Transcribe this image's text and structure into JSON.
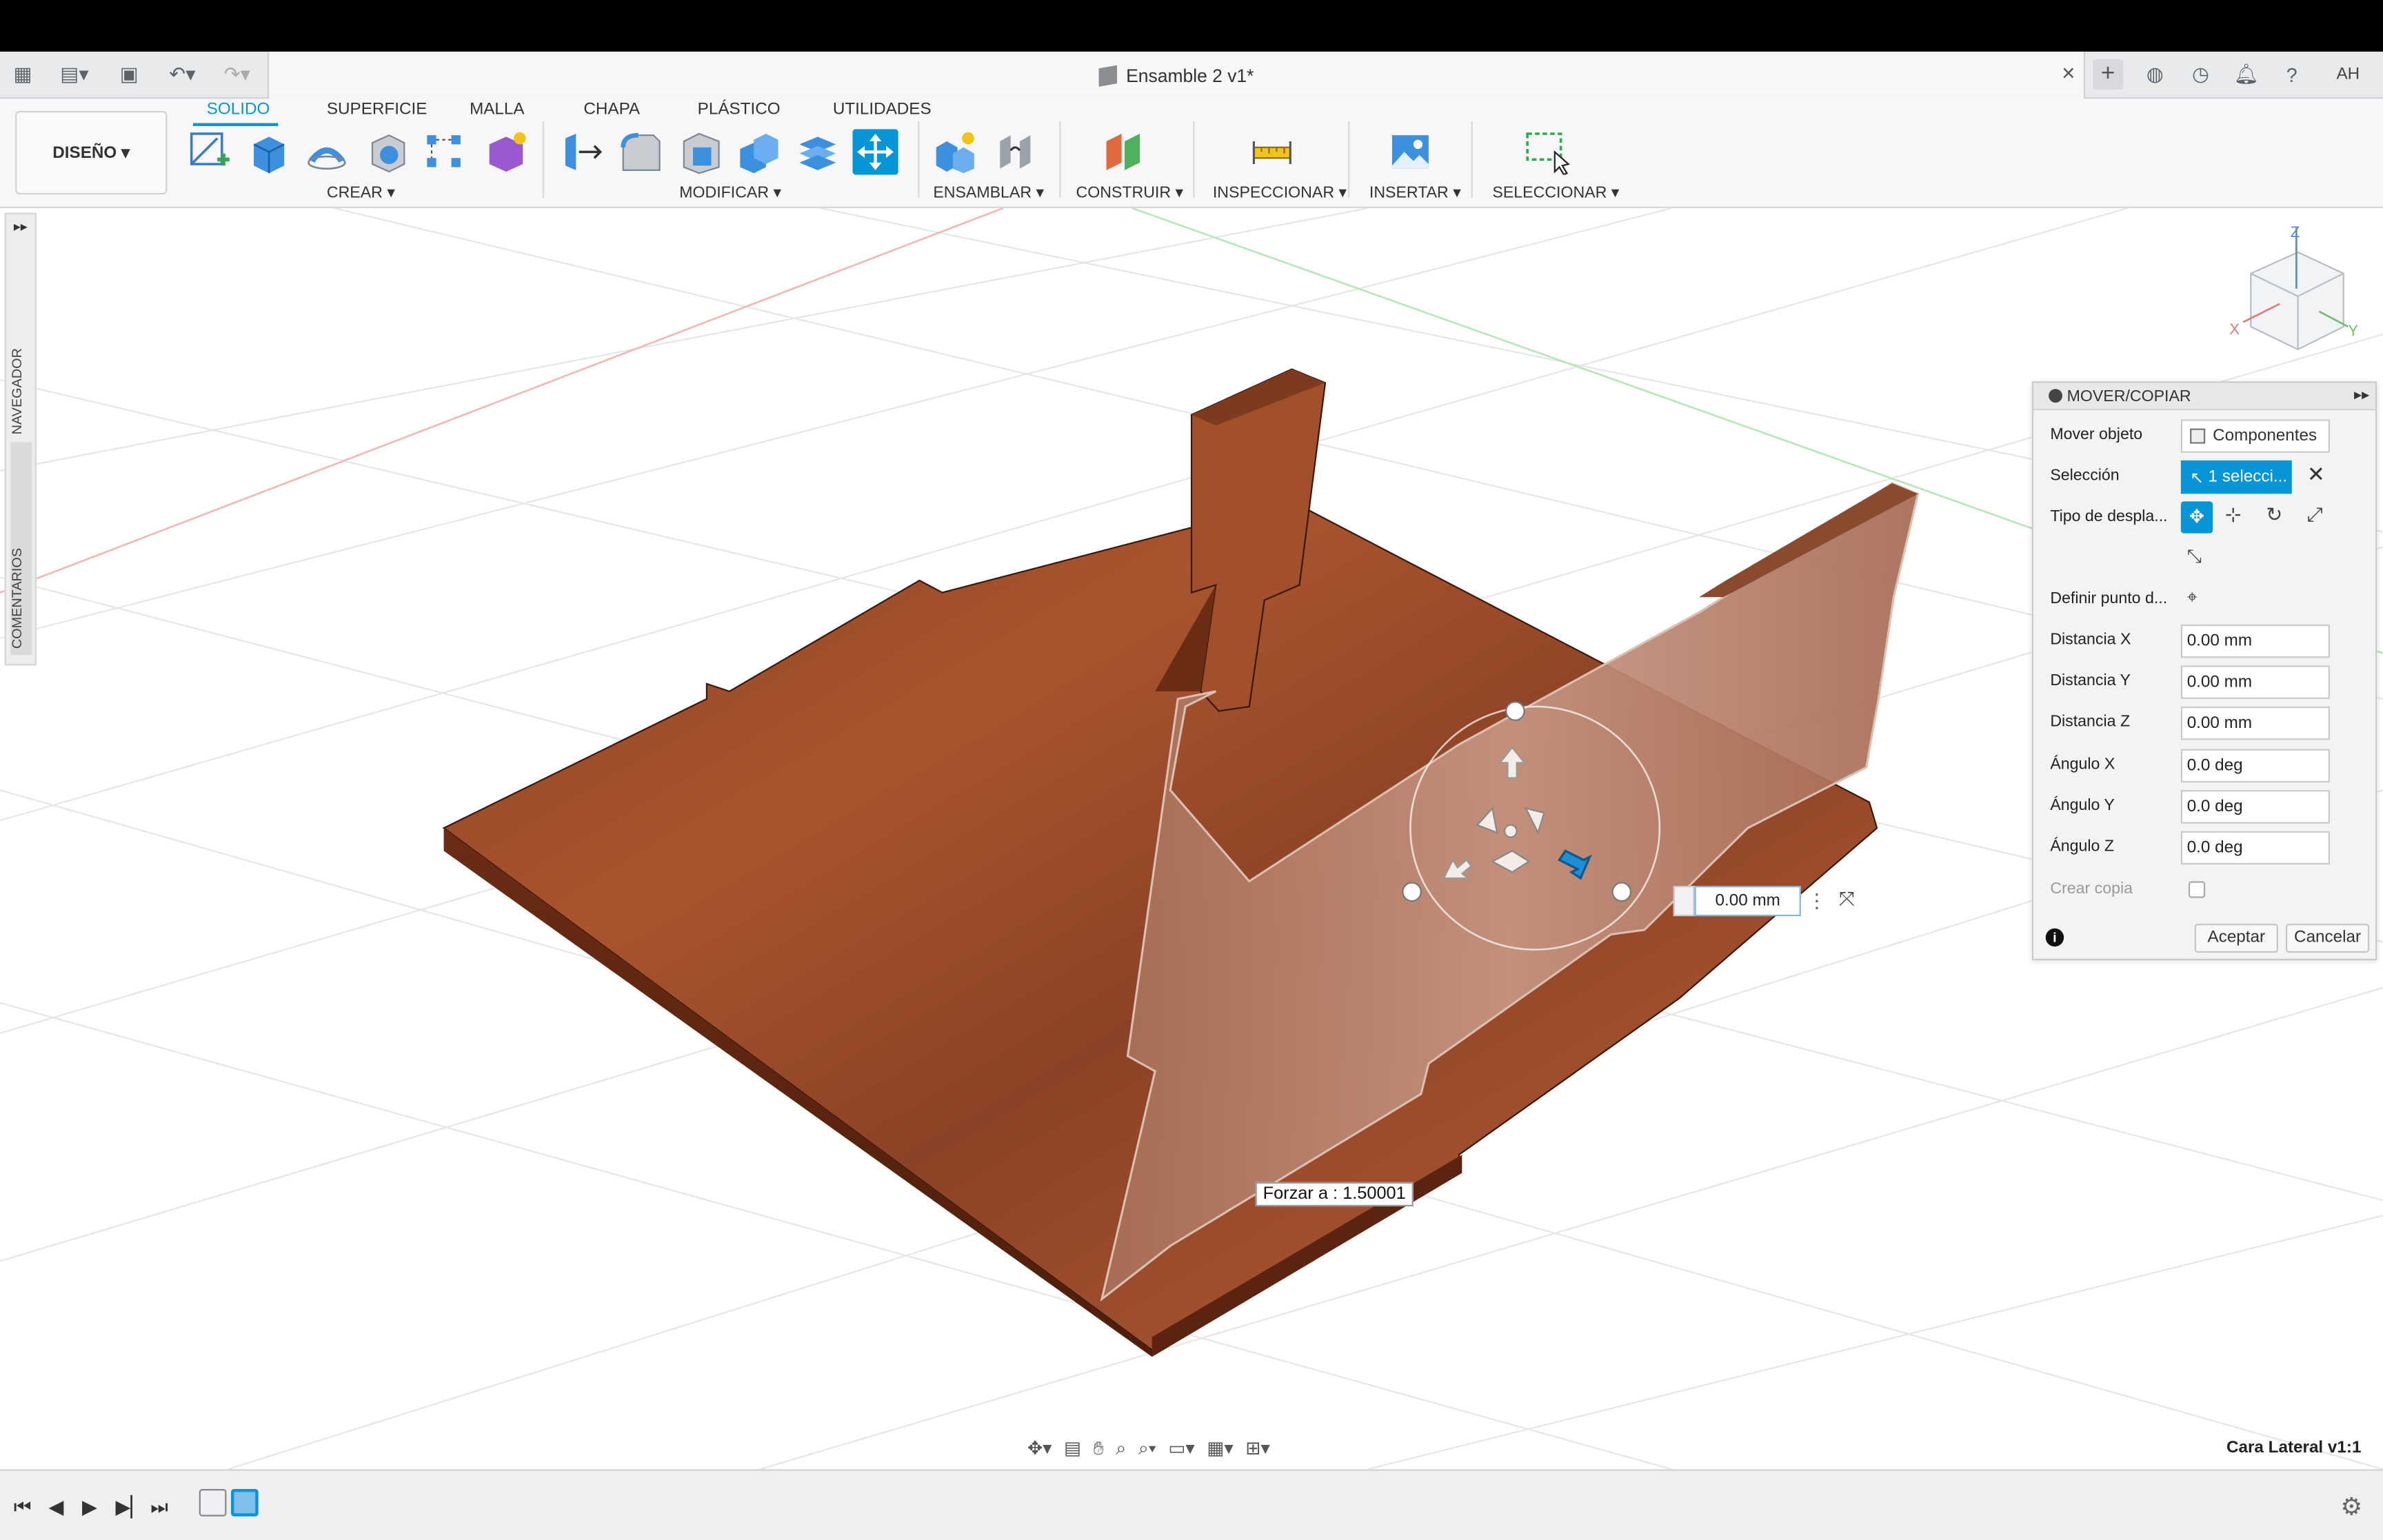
{
  "window": {
    "title": "Ensamble 2 v1*",
    "avatar": "AH"
  },
  "workspace": {
    "label": "DISEÑO"
  },
  "tabs": [
    {
      "label": "SOLIDO",
      "active": true
    },
    {
      "label": "SUPERFICIE"
    },
    {
      "label": "MALLA"
    },
    {
      "label": "CHAPA"
    },
    {
      "label": "PLÁSTICO"
    },
    {
      "label": "UTILIDADES"
    }
  ],
  "groups": {
    "crear": "CREAR",
    "modificar": "MODIFICAR",
    "ensamblar": "ENSAMBLAR",
    "construir": "CONSTRUIR",
    "inspeccionar": "INSPECCIONAR",
    "insertar": "INSERTAR",
    "seleccionar": "SELECCIONAR"
  },
  "side_panel": {
    "nav": "NAVEGADOR",
    "comments": "COMENTARIOS"
  },
  "dialog": {
    "title": "MOVER/COPIAR",
    "move_object_label": "Mover objeto",
    "move_object_value": "Componentes",
    "selection_label": "Selección",
    "selection_value": "1 selecci...",
    "move_type_label": "Tipo de despla...",
    "pivot_label": "Definir punto d...",
    "fields": [
      {
        "label": "Distancia X",
        "value": "0.00 mm"
      },
      {
        "label": "Distancia Y",
        "value": "0.00 mm"
      },
      {
        "label": "Distancia Z",
        "value": "0.00 mm"
      },
      {
        "label": "Ángulo X",
        "value": "0.0 deg"
      },
      {
        "label": "Ángulo Y",
        "value": "0.0 deg"
      },
      {
        "label": "Ángulo Z",
        "value": "0.0 deg"
      }
    ],
    "copy_label": "Crear copia",
    "accept": "Aceptar",
    "cancel": "Cancelar"
  },
  "viewport": {
    "float_input": "0.00 mm",
    "snap_hint": "Forzar a : 1.50001",
    "context_label": "Cara Lateral v1:1"
  },
  "viewcube": {
    "z": "Z",
    "x": "X",
    "y": "Y"
  },
  "colors": {
    "accent": "#0696d7",
    "wood": "#8a3f22"
  }
}
